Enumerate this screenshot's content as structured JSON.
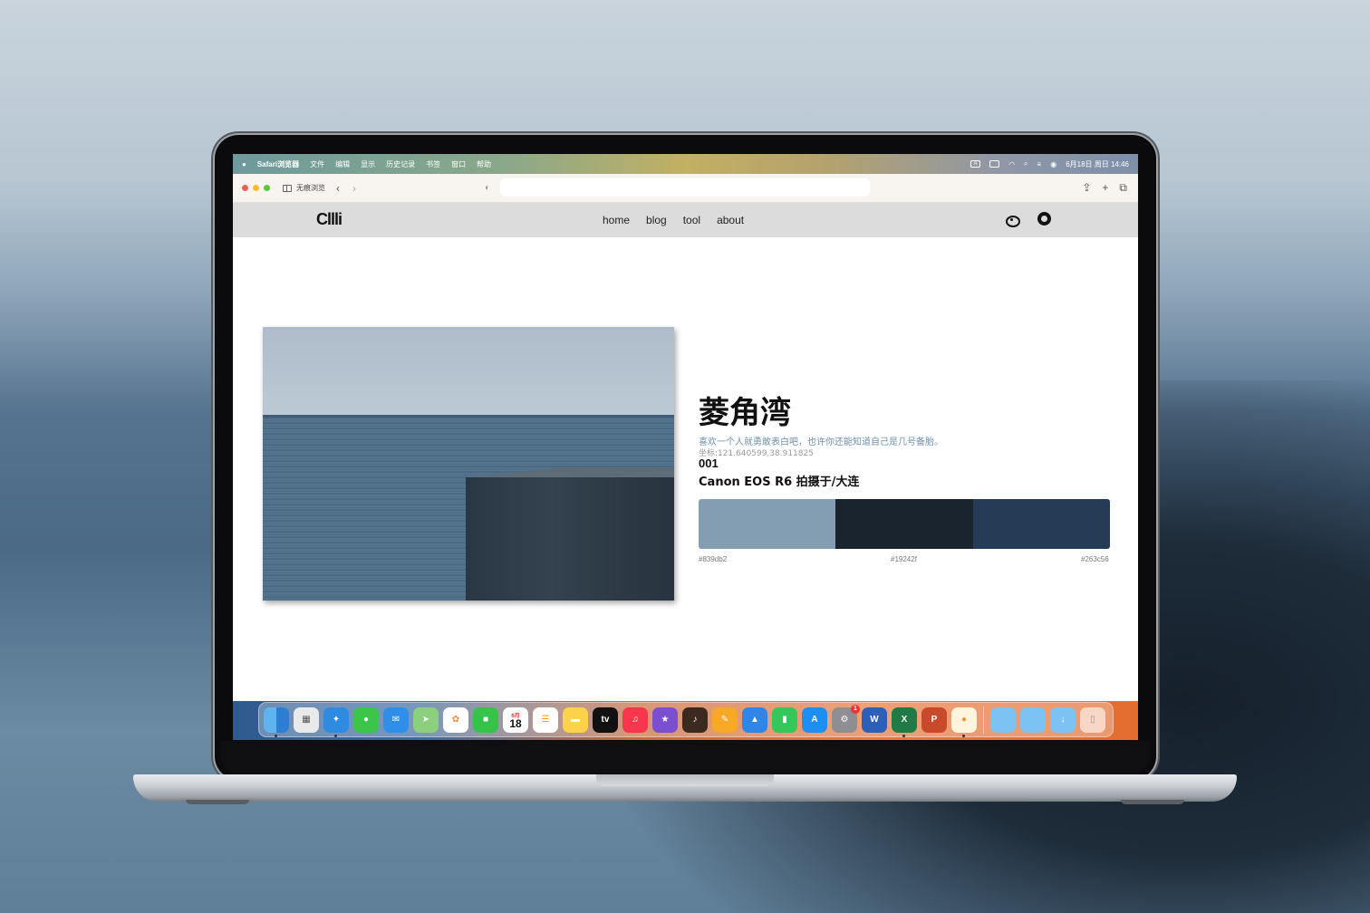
{
  "menubar": {
    "apple": "",
    "app": "Safari浏览器",
    "items": [
      "文件",
      "编辑",
      "显示",
      "历史记录",
      "书签",
      "窗口",
      "帮助"
    ],
    "input_badge": "A",
    "datetime": "6月18日 周日 14:46"
  },
  "toolbar": {
    "private_label": "无痕浏览",
    "back": "‹",
    "forward": "›",
    "url": "",
    "share": "⇪",
    "new_tab": "+",
    "tabs": "⧉"
  },
  "site": {
    "logo": "Cllli",
    "nav": [
      "home",
      "blog",
      "tool",
      "about"
    ]
  },
  "post": {
    "title": "菱角湾",
    "description": "喜欢一个人就勇敢表白吧，也许你还能知道自己是几号备胎。",
    "coordinates": "坐标:121.640599,38.911825",
    "number": "001",
    "camera": "Canon EOS R6 拍摄于/大连",
    "palette": [
      {
        "hex": "#839db2",
        "color": "#839db2"
      },
      {
        "hex": "#19242f",
        "color": "#19242f"
      },
      {
        "hex": "#263c56",
        "color": "#263c56"
      }
    ]
  },
  "dock": {
    "calendar_month": "6月",
    "calendar_day": "18",
    "tv_label": "tv",
    "badge_count": "1"
  }
}
